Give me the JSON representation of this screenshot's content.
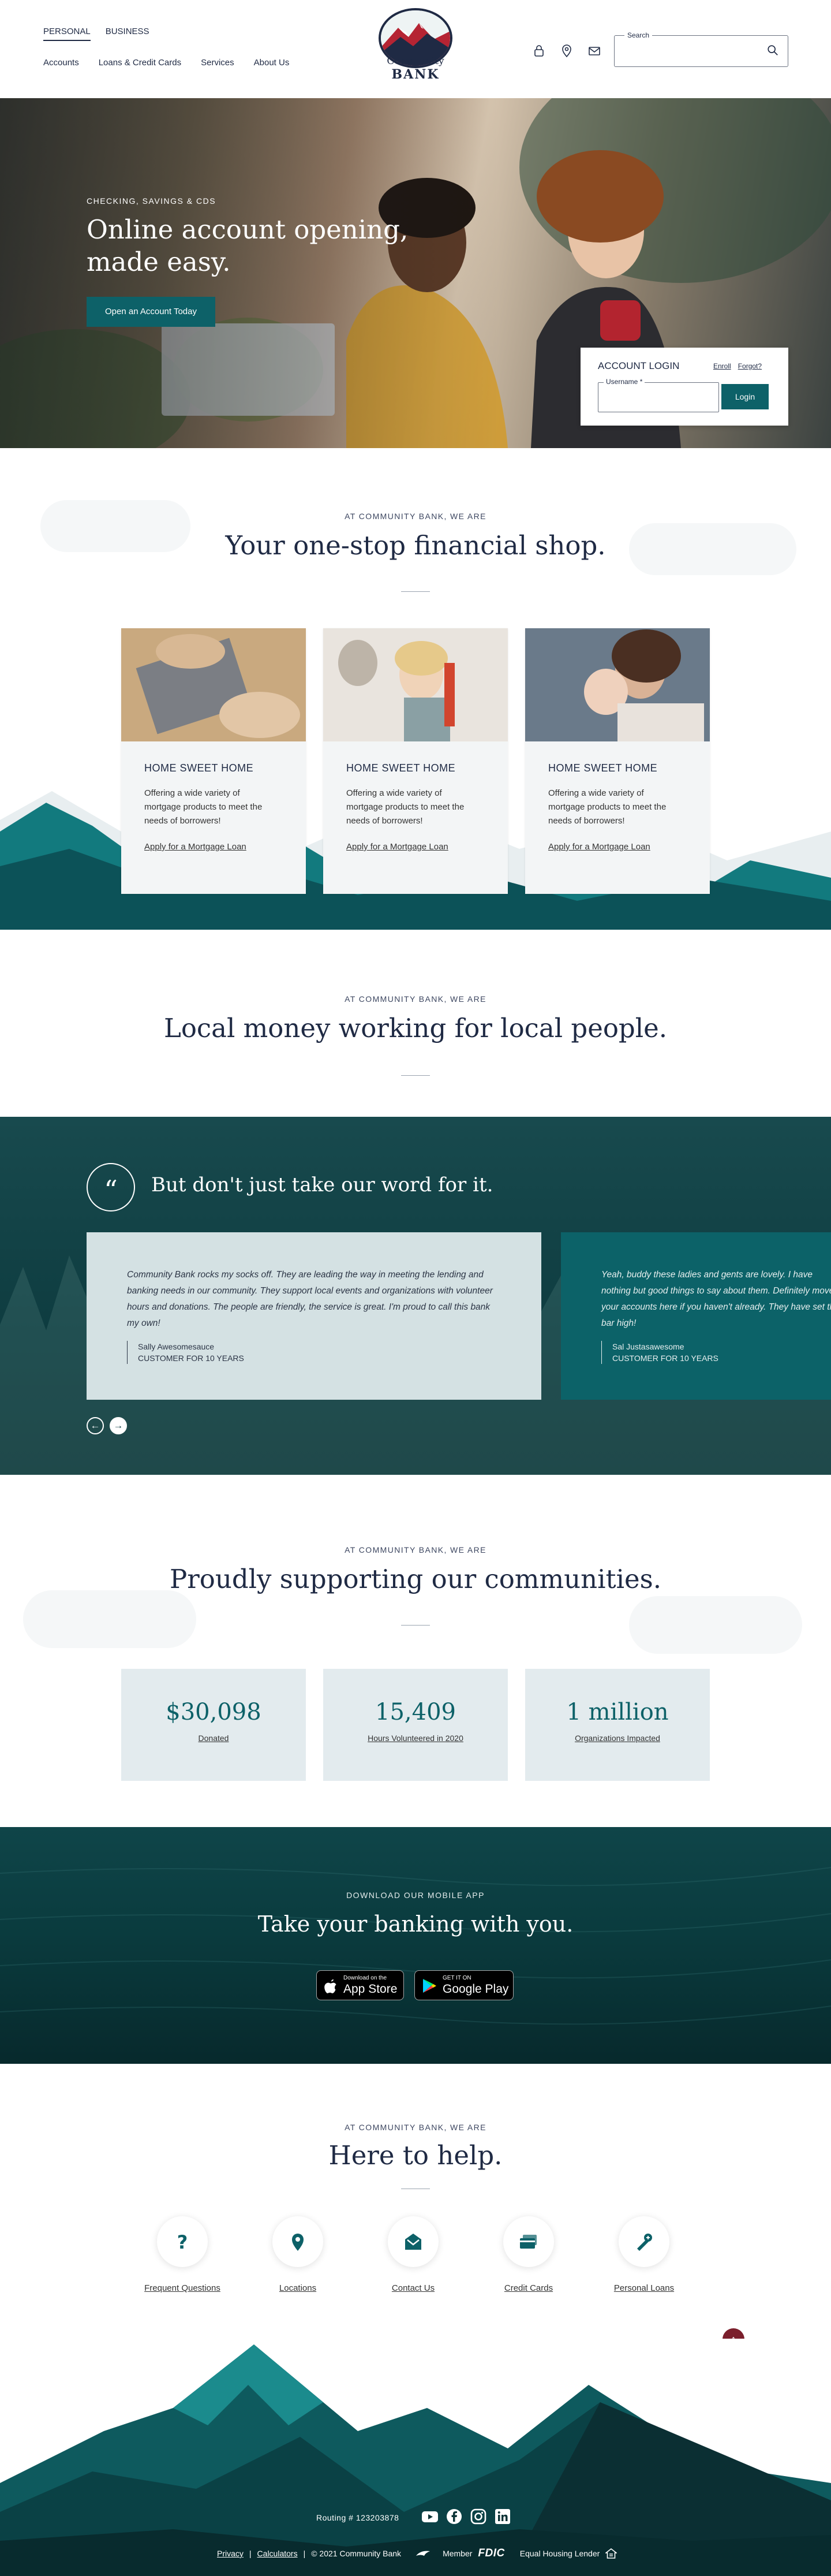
{
  "header": {
    "tabs": [
      "PERSONAL",
      "BUSINESS"
    ],
    "nav": [
      "Accounts",
      "Loans & Credit Cards",
      "Services",
      "About Us"
    ],
    "logo_line1": "Community",
    "logo_line2": "BANK",
    "icons": [
      "lock-icon",
      "location-icon",
      "mail-icon"
    ],
    "search_label": "Search"
  },
  "hero": {
    "eyebrow": "CHECKING, SAVINGS & CDS",
    "title": "Online account opening, made easy.",
    "button": "Open an Account Today",
    "login": {
      "title": "ACCOUNT LOGIN",
      "enroll": "Enroll",
      "forgot": "Forgot?",
      "username_label": "Username *",
      "button": "Login"
    }
  },
  "onestop": {
    "eyebrow": "AT COMMUNITY BANK, WE ARE",
    "title": "Your one-stop financial shop.",
    "cards": [
      {
        "title": "HOME SWEET HOME",
        "text": "Offering a wide variety of mortgage products to meet the needs of borrowers!",
        "link": "Apply for a Mortgage Loan"
      },
      {
        "title": "HOME SWEET HOME",
        "text": "Offering a wide variety of mortgage products to meet the needs of borrowers!",
        "link": "Apply for a Mortgage Loan"
      },
      {
        "title": "HOME SWEET HOME",
        "text": "Offering a wide variety of mortgage products to meet the needs of borrowers!",
        "link": "Apply for a Mortgage Loan"
      }
    ]
  },
  "local": {
    "eyebrow": "AT COMMUNITY BANK, WE ARE",
    "title": "Local money working for local people."
  },
  "testimonials": {
    "title": "But don't just take our word for it.",
    "items": [
      {
        "quote": "Community Bank rocks my socks off. They are leading the way in meeting the lending and banking needs in our community. They support local events and organizations with volunteer hours and donations. The people are friendly, the service is great. I'm proud to call this bank my own!",
        "name": "Sally Awesomesauce",
        "role": "CUSTOMER FOR 10 YEARS"
      },
      {
        "quote": "Yeah, buddy these ladies and gents are lovely. I have nothing but good things to say about them. Definitely move your accounts here if you haven't already. They have set the bar high!",
        "name": "Sal Justasawesome",
        "role": "CUSTOMER FOR 10 YEARS"
      }
    ]
  },
  "communities": {
    "eyebrow": "AT COMMUNITY BANK, WE ARE",
    "title": "Proudly supporting our communities.",
    "stats": [
      {
        "value": "$30,098",
        "label": "Donated"
      },
      {
        "value": "15,409",
        "label": "Hours Volunteered in 2020"
      },
      {
        "value": "1 million",
        "label": "Organizations Impacted"
      }
    ]
  },
  "app": {
    "eyebrow": "DOWNLOAD OUR MOBILE APP",
    "title": "Take your banking with you.",
    "app_store_small": "Download on the",
    "app_store_big": "App Store",
    "google_small": "GET IT ON",
    "google_big": "Google Play"
  },
  "help": {
    "eyebrow": "AT COMMUNITY BANK, WE ARE",
    "title": "Here to help.",
    "items": [
      {
        "label": "Frequent Questions",
        "icon": "question-icon"
      },
      {
        "label": "Locations",
        "icon": "location-icon"
      },
      {
        "label": "Contact Us",
        "icon": "envelope-icon"
      },
      {
        "label": "Credit Cards",
        "icon": "credit-card-icon"
      },
      {
        "label": "Personal Loans",
        "icon": "loan-icon"
      }
    ]
  },
  "footer": {
    "routing": "Routing # 123203878",
    "social": [
      "youtube-icon",
      "facebook-icon",
      "instagram-icon",
      "linkedin-icon"
    ],
    "privacy": "Privacy",
    "calculators": "Calculators",
    "copyright": "© 2021 Community Bank",
    "member": "Member",
    "fdic": "FDIC",
    "equal_housing": "Equal Housing Lender"
  },
  "colors": {
    "navy": "#1f2a44",
    "teal": "#0d6168",
    "dark_teal": "#0e3c40",
    "maroon": "#7b1f2c",
    "stat_bg": "#e3ebee"
  }
}
